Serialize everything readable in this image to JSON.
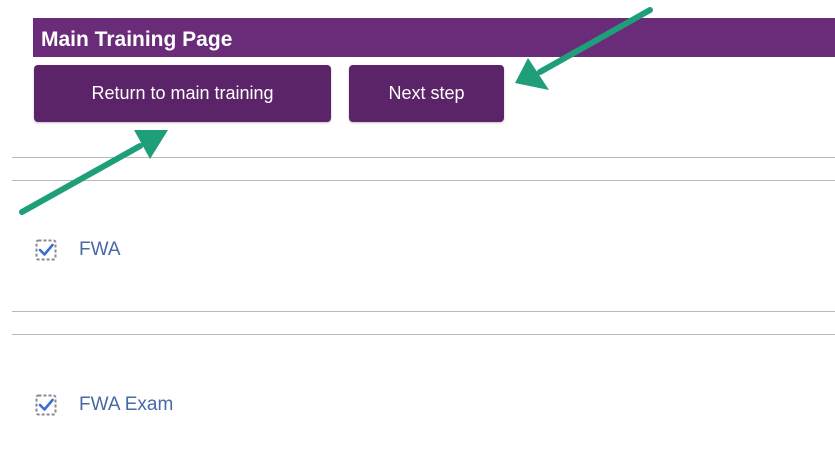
{
  "header": {
    "title": "Main Training Page",
    "color": "#6a2c79"
  },
  "buttons": {
    "return_label": "Return to main training",
    "next_label": "Next step",
    "color": "#5b2468"
  },
  "items": [
    {
      "label": "FWA",
      "checked": true,
      "icon": "checked-box-icon"
    },
    {
      "label": "FWA Exam",
      "checked": true,
      "icon": "checked-box-icon"
    }
  ],
  "annotations": {
    "arrow_color": "#1f9e7a",
    "arrows": [
      "arrow-to-next-step",
      "arrow-to-return-button"
    ]
  }
}
